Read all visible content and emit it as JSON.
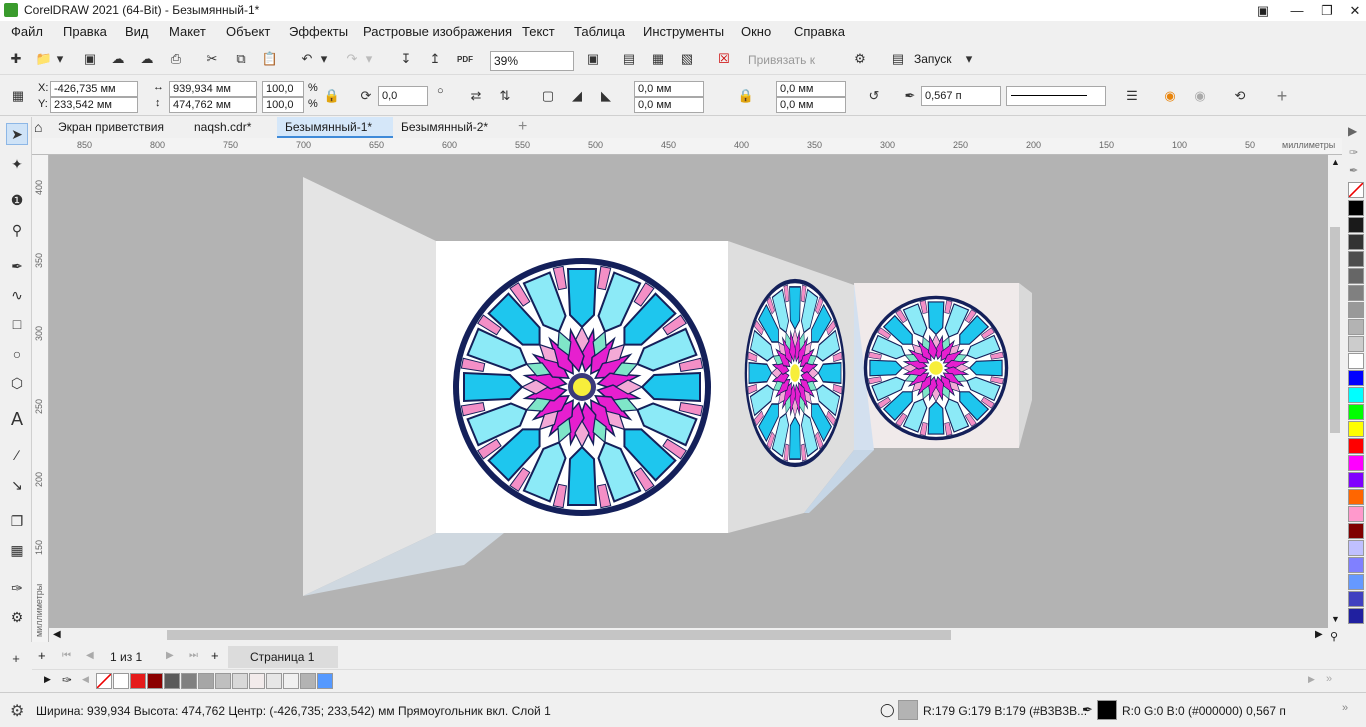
{
  "window": {
    "title": "CorelDRAW 2021 (64-Bit) - Безымянный-1*"
  },
  "menu": [
    "Файл",
    "Правка",
    "Вид",
    "Макет",
    "Объект",
    "Эффекты",
    "Растровые изображения",
    "Текст",
    "Таблица",
    "Инструменты",
    "Окно",
    "Справка"
  ],
  "toolbar1": {
    "zoom": "39%",
    "snap_label": "Привязать к",
    "launch_label": "Запуск",
    "pdf_label": "PDF"
  },
  "props": {
    "x_label": "X:",
    "x": "-426,735 мм",
    "y_label": "Y:",
    "y": "233,542 мм",
    "width": "939,934 мм",
    "height": "474,762 мм",
    "scale_x": "100,0",
    "scale_y": "100,0",
    "percent": "%",
    "angle": "0,0",
    "corner1": "0,0 мм",
    "corner2": "0,0 мм",
    "corner3": "0,0 мм",
    "corner4": "0,0 мм",
    "outline_width": "0,567 п"
  },
  "tabs": [
    {
      "label": "Экран приветствия",
      "active": false
    },
    {
      "label": "naqsh.cdr*",
      "active": false
    },
    {
      "label": "Безымянный-1*",
      "active": true
    },
    {
      "label": "Безымянный-2*",
      "active": false
    }
  ],
  "ruler_h": {
    "unit": "миллиметры",
    "ticks": [
      "850",
      "800",
      "750",
      "700",
      "650",
      "600",
      "550",
      "500",
      "450",
      "400",
      "350",
      "300",
      "250",
      "200",
      "150",
      "100",
      "50"
    ]
  },
  "ruler_v": {
    "unit": "миллиметры",
    "ticks": [
      "400",
      "350",
      "300",
      "250",
      "200",
      "150"
    ]
  },
  "pagebar": {
    "page_counter": "1 из 1",
    "page_tab": "Страница 1"
  },
  "palette_right": [
    "#000000",
    "#1a1a1a",
    "#333333",
    "#4d4d4d",
    "#666666",
    "#808080",
    "#999999",
    "#b3b3b3",
    "#cccccc",
    "#ffffff",
    "#0000ff",
    "#00ffff",
    "#00ff00",
    "#ffff00",
    "#ff0000",
    "#ff00ff",
    "#8000ff",
    "#ff6600",
    "#ff99cc",
    "#800000",
    "#c0c0ff",
    "#8080ff",
    "#6699ff",
    "#4040c0",
    "#2020a0"
  ],
  "doc_palette": [
    "#ffffff",
    "#e51b1b",
    "#8b0000",
    "#5a5a5a",
    "#808080",
    "#a6a6a6",
    "#bfbfbf",
    "#d9d9d9",
    "#f2ebeb",
    "#e6e6e6",
    "#f0f0f0",
    "#b3b3b3",
    "#5599ff"
  ],
  "status": {
    "dims": "Ширина: 939,934  Высота: 474,762  Центр: (-426,735; 233,542)  мм",
    "object": "Прямоугольник вкл. Слой 1",
    "fill": "R:179 G:179 B:179 (#B3B3B...",
    "outline": "R:0 G:0 B:0 (#000000)  0,567 п"
  },
  "colors": {
    "fill_swatch": "#b3b3b3",
    "outline_swatch": "#000000"
  }
}
